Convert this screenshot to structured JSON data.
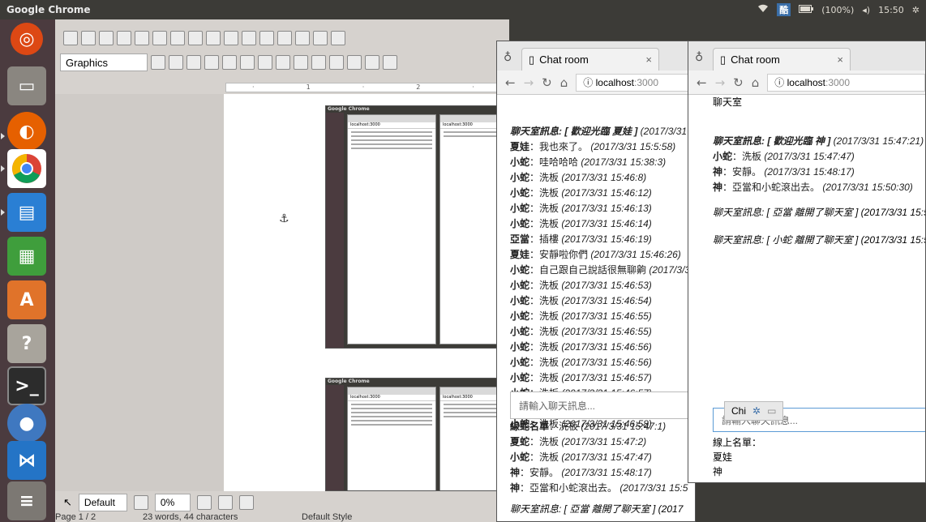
{
  "top_bar": {
    "app_title": "Google Chrome",
    "indicators": {
      "wifi": "wifi-icon",
      "ime_badge": "酷",
      "battery": "(100%)",
      "volume": "volume-icon",
      "time": "15:50",
      "settings": "gear-icon"
    }
  },
  "launcher": [
    "ubuntu-dash-icon",
    "files-icon",
    "firefox-icon",
    "chrome-icon",
    "writer-icon",
    "calc-icon",
    "software-center-icon",
    "help-icon",
    "terminal-icon",
    "droplet-icon",
    "vscode-icon",
    "trash-icon"
  ],
  "writer": {
    "paragraph_style": "Graphics",
    "style_select": "Default",
    "transparency": "0%",
    "status": {
      "page": "Page 1 / 2",
      "words": "23 words, 44 characters",
      "style": "Default Style"
    },
    "thumb_title": "Google Chrome",
    "thumb_tab": "Chat room",
    "thumb_url": "localhost:3000",
    "thumb_room": "聊天室"
  },
  "chrome_left": {
    "tab_title": "Chat room",
    "url_domain": "localhost",
    "url_port": ":3000",
    "messages": [
      {
        "user": "聊天室訊息: [ 歡迎光臨 夏娃 ]",
        "text": "",
        "time": "(2017/3/31",
        "sys": true
      },
      {
        "user": "夏娃",
        "text": "：我也來了。",
        "time": "(2017/3/31 15:5:58)"
      },
      {
        "user": "小蛇",
        "text": "：哇哈哈哈",
        "time": "(2017/3/31 15:38:3)"
      },
      {
        "user": "小蛇",
        "text": "：洗板",
        "time": "(2017/3/31 15:46:8)"
      },
      {
        "user": "小蛇",
        "text": "：洗板",
        "time": "(2017/3/31 15:46:12)"
      },
      {
        "user": "小蛇",
        "text": "：洗板",
        "time": "(2017/3/31 15:46:13)"
      },
      {
        "user": "小蛇",
        "text": "：洗板",
        "time": "(2017/3/31 15:46:14)"
      },
      {
        "user": "亞當",
        "text": "：插樓",
        "time": "(2017/3/31 15:46:19)"
      },
      {
        "user": "夏娃",
        "text": "：安靜啦你們",
        "time": "(2017/3/31 15:46:26)"
      },
      {
        "user": "小蛇",
        "text": "：自己跟自己說話很無聊齁",
        "time": "(2017/3/3"
      },
      {
        "user": "小蛇",
        "text": "：洗板",
        "time": "(2017/3/31 15:46:53)"
      },
      {
        "user": "小蛇",
        "text": "：洗板",
        "time": "(2017/3/31 15:46:54)"
      },
      {
        "user": "小蛇",
        "text": "：洗板",
        "time": "(2017/3/31 15:46:55)"
      },
      {
        "user": "小蛇",
        "text": "：洗板",
        "time": "(2017/3/31 15:46:55)"
      },
      {
        "user": "小蛇",
        "text": "：洗板",
        "time": "(2017/3/31 15:46:56)"
      },
      {
        "user": "小蛇",
        "text": "：洗板",
        "time": "(2017/3/31 15:46:56)"
      },
      {
        "user": "小蛇",
        "text": "：洗板",
        "time": "(2017/3/31 15:46:57)"
      },
      {
        "user": "小蛇",
        "text": "：洗板",
        "time": "(2017/3/31 15:46:57)"
      },
      {
        "user": "小蛇",
        "text": "：洗板",
        "time": "(2017/3/31 15:46:58)"
      },
      {
        "user": "小蛇",
        "text": "：洗板",
        "time": "(2017/3/31 15:46:58)"
      }
    ],
    "input_placeholder": "請輸入聊天訊息...",
    "lower_messages": [
      {
        "user": "線蛇名單",
        "text": "：洗板",
        "time": "(2017/3/31 15:47:1)"
      },
      {
        "user": "夏蛇",
        "text": "：洗板",
        "time": "(2017/3/31 15:47:2)"
      },
      {
        "user": "小蛇",
        "text": "：洗板",
        "time": "(2017/3/31 15:47:47)"
      },
      {
        "user": "神",
        "text": "：安靜。",
        "time": "(2017/3/31 15:48:17)"
      },
      {
        "user": "神",
        "text": "：亞當和小蛇滾出去。",
        "time": "(2017/3/31 15:5"
      }
    ],
    "bottom_sys": "聊天室訊息: [ 亞當 離開了聊天室 ] (2017"
  },
  "chrome_right": {
    "tab_title": "Chat room",
    "url_domain": "localhost",
    "url_port": ":3000",
    "room_title": "聊天室",
    "messages": [
      {
        "user": "聊天室訊息: [ 歡迎光臨 神 ]",
        "text": "",
        "time": "(2017/3/31 15:47:21)",
        "sys": true
      },
      {
        "user": "小蛇",
        "text": "：洗板",
        "time": "(2017/3/31 15:47:47)"
      },
      {
        "user": "神",
        "text": "：安靜。",
        "time": "(2017/3/31 15:48:17)"
      },
      {
        "user": "神",
        "text": "：亞當和小蛇滾出去。",
        "time": "(2017/3/31 15:50:30)"
      }
    ],
    "sys_messages": [
      "聊天室訊息: [ 亞當 離開了聊天室 ] (2017/3/31 15:5",
      "聊天室訊息: [ 小蛇 離開了聊天室 ] (2017/3/31 15:5"
    ],
    "input_placeholder": "請輸入聊天訊息...",
    "ime_label": "Chi",
    "online_title": "線上名單：",
    "online_users": [
      "夏娃",
      "神"
    ]
  }
}
